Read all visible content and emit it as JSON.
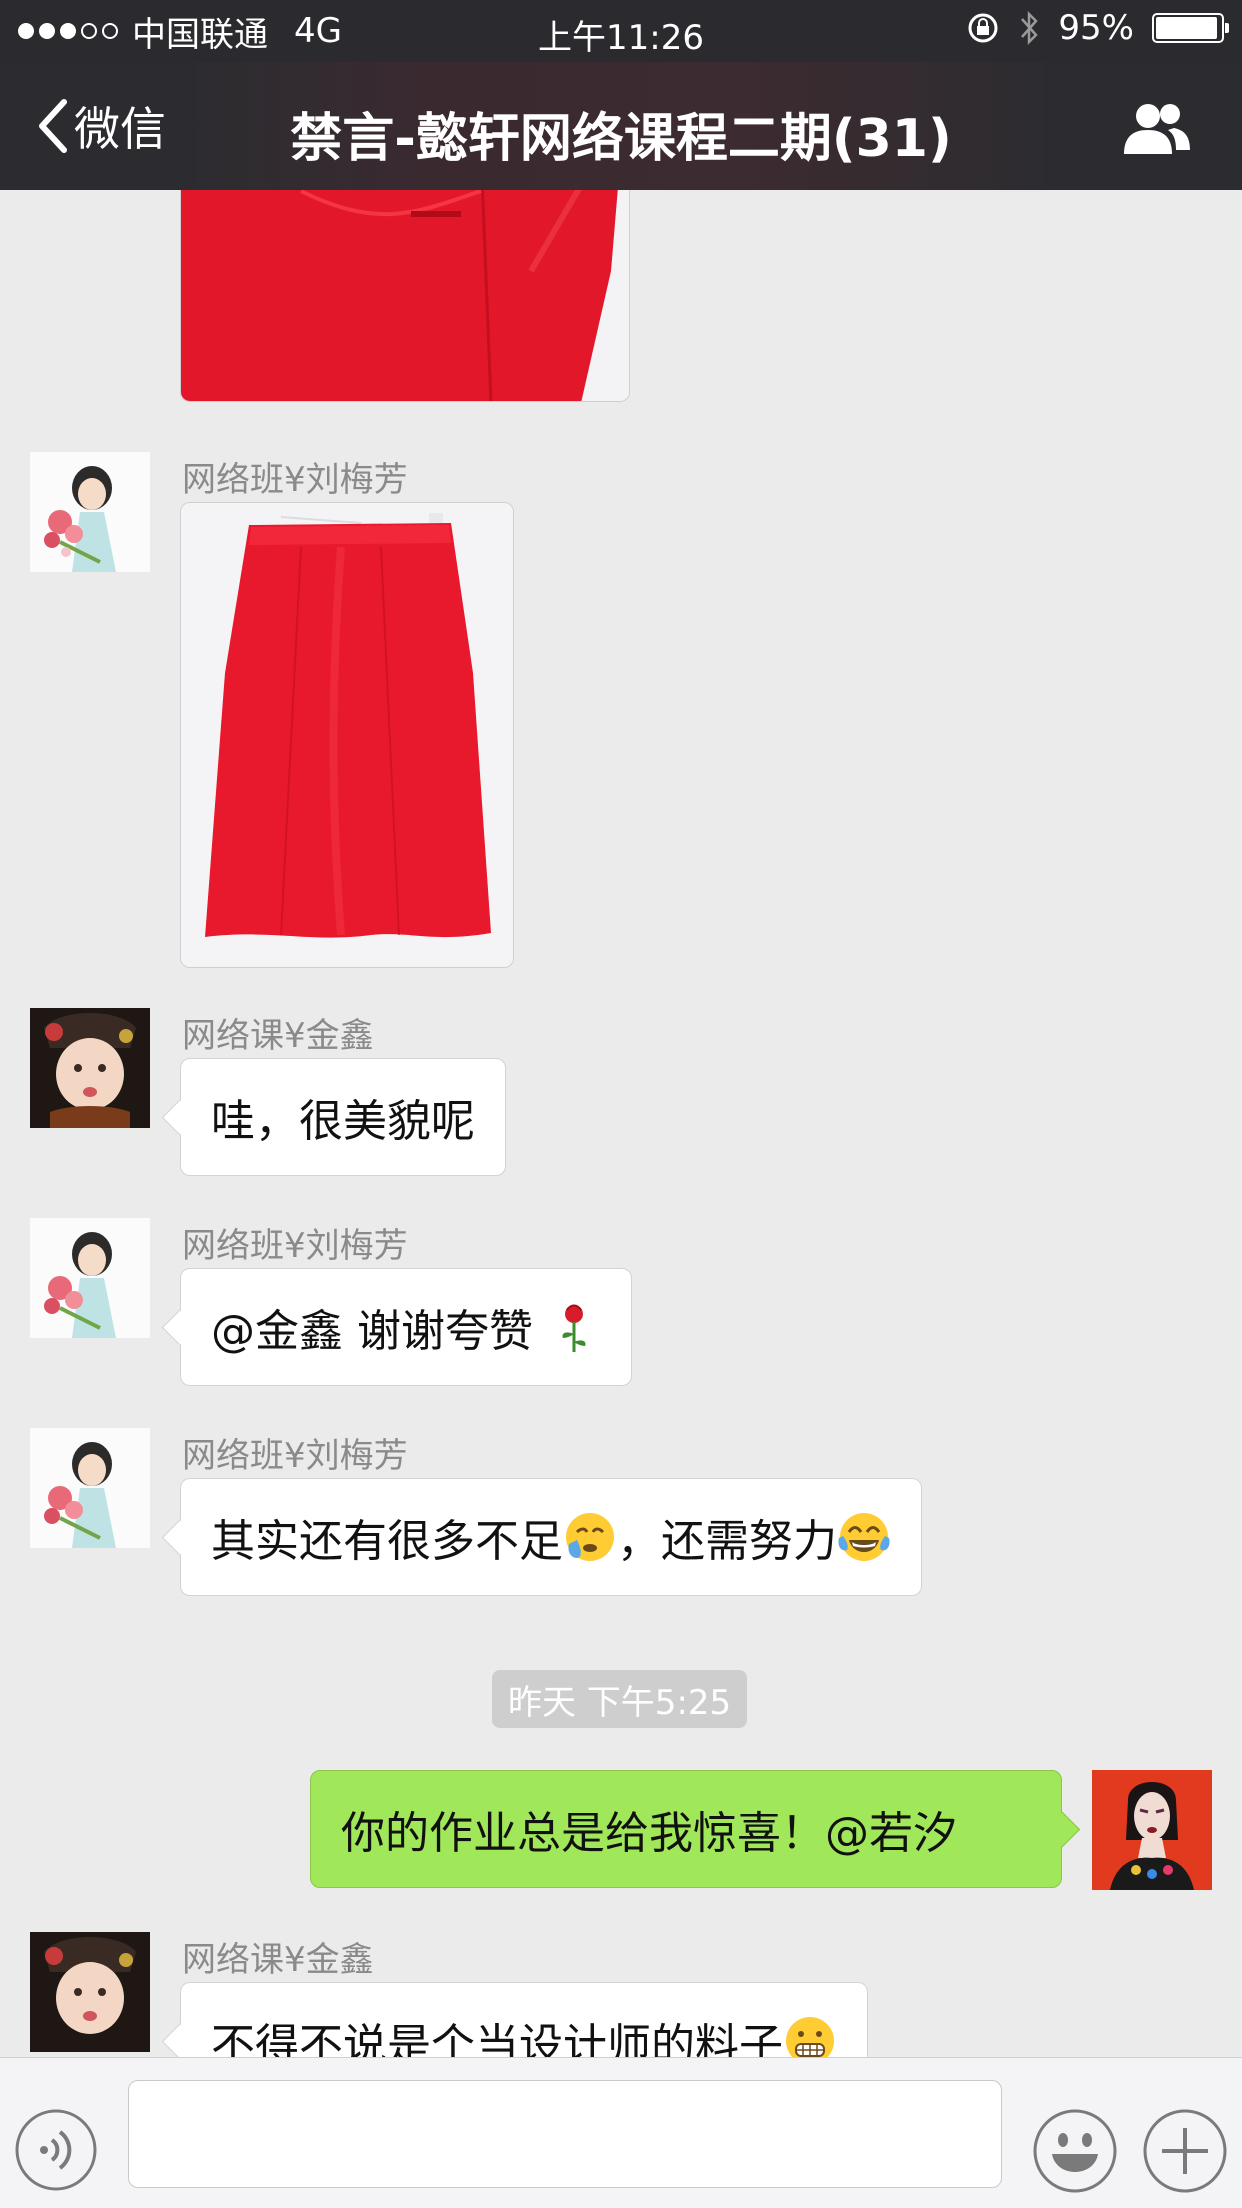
{
  "status": {
    "carrier": "中国联通",
    "network": "4G",
    "time": "上午11:26",
    "battery": "95%",
    "battery_level": 0.95,
    "signal_bars": 3,
    "signal_total": 5
  },
  "nav": {
    "back_label": "微信",
    "title": "禁言-懿轩网络课程二期(31)"
  },
  "messages": {
    "m1": {
      "sender": "网络班¥刘梅芳",
      "type": "image",
      "content": "red-skirt-photo"
    },
    "m2": {
      "sender": "网络课¥金鑫",
      "text": "哇，很美貌呢"
    },
    "m3": {
      "sender": "网络班¥刘梅芳",
      "text": "@金鑫 谢谢夸赞"
    },
    "m4": {
      "sender": "网络班¥刘梅芳",
      "text_a": "其实还有很多不足",
      "text_b": "，还需努力"
    },
    "timestamp": "昨天 下午5:25",
    "m5": {
      "sender": "self",
      "text": "你的作业总是给我惊喜！@若汐"
    },
    "m6": {
      "sender": "网络课¥金鑫",
      "text": "不得不说是个当设计师的料子"
    }
  },
  "colors": {
    "nav_bg": "#2c2c30",
    "chat_bg": "#ebebeb",
    "self_bubble": "#a0e75a",
    "other_bubble": "#ffffff",
    "skirt_red": "#e8192c"
  },
  "icons": {
    "back": "chevron-left-icon",
    "members": "group-members-icon",
    "voice": "voice-icon",
    "emoji": "emoji-face-icon",
    "more": "plus-icon",
    "rose": "rose-emoji",
    "cry": "crying-emoji",
    "laugh": "tears-of-joy-emoji",
    "grimace": "grimacing-emoji"
  }
}
